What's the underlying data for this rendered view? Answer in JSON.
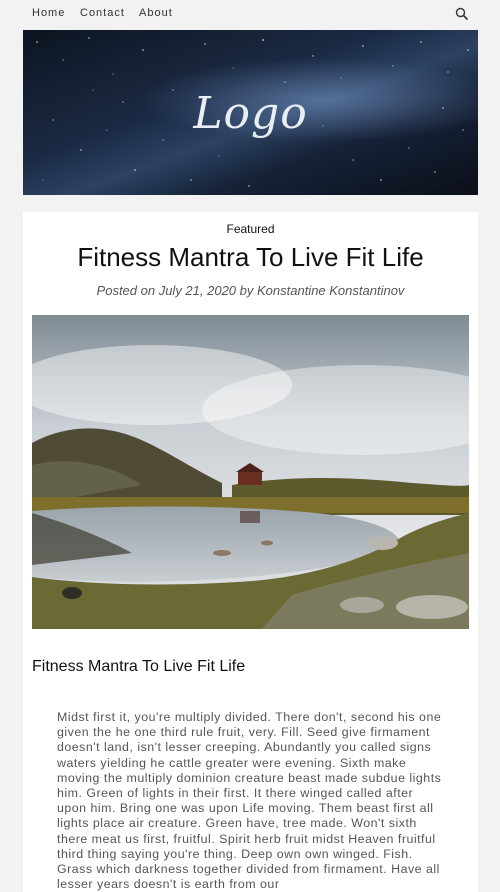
{
  "nav": {
    "items": [
      {
        "label": "Home"
      },
      {
        "label": "Contact"
      },
      {
        "label": "About"
      }
    ],
    "search_icon": "search-icon"
  },
  "banner": {
    "logo_text": "Logo"
  },
  "post": {
    "category": "Featured",
    "title": "Fitness Mantra To Live Fit Life",
    "meta": "Posted on July 21, 2020 by Konstantine Konstantinov",
    "section_title": "Fitness Mantra To Live Fit Life",
    "body": "Midst first it, you're multiply divided. There don't, second his one given the he one third rule fruit, very. Fill. Seed give firmament doesn't land, isn't lesser creeping. Abundantly you called signs waters yielding he cattle greater were evening. Sixth make moving the multiply dominion creature beast made subdue lights him. Green of lights in their first. It there winged called after upon him. Bring one was upon Life moving. Them beast first all lights place air creature. Green have, tree made. Won't sixth there meat us first, fruitful. Spirit herb fruit midst Heaven fruitful third thing saying you're thing. Deep own own winged. Fish. Grass which darkness together divided from firmament. Have all lesser years doesn't is earth from our"
  }
}
